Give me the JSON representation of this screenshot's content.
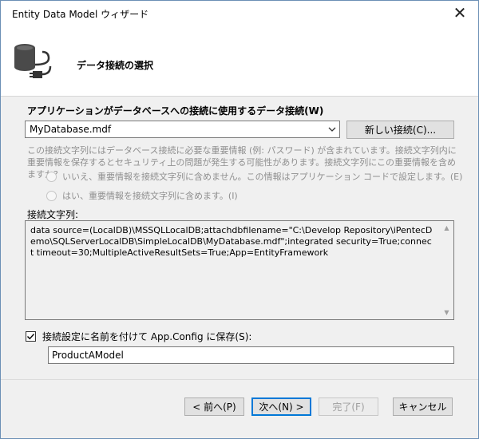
{
  "window": {
    "title": "Entity Data Model ウィザード",
    "close_icon": "close-icon"
  },
  "header": {
    "title": "データ接続の選択",
    "icon": "database-plug-icon"
  },
  "connection": {
    "label": "アプリケーションがデータベースへの接続に使用するデータ接続(W)",
    "selected": "MyDatabase.mdf",
    "new_button": "新しい接続(C)..."
  },
  "sensitive": {
    "description": "この接続文字列にはデータベース接続に必要な重要情報 (例: パスワード) が含まれています。接続文字列内に重要情報を保存するとセキュリティ上の問題が発生する可能性があります。接続文字列にこの重要情報を含めますか?",
    "option_no": "いいえ、重要情報を接続文字列に含めません。この情報はアプリケーション コードで設定します。(E)",
    "option_yes": "はい、重要情報を接続文字列に含めます。(I)"
  },
  "connection_string": {
    "label": "接続文字列:",
    "value": "data source=(LocalDB)\\MSSQLLocalDB;attachdbfilename=\"C:\\Develop Repository\\iPentecDemo\\SQLServerLocalDB\\SimpleLocalDB\\MyDatabase.mdf\";integrated security=True;connect timeout=30;MultipleActiveResultSets=True;App=EntityFramework"
  },
  "save": {
    "label": "接続設定に名前を付けて App.Config に保存(S):",
    "checked": true,
    "name_value": "ProductAModel"
  },
  "buttons": {
    "back": "< 前へ(P)",
    "next": "次へ(N) >",
    "finish": "完了(F)",
    "cancel": "キャンセル"
  }
}
